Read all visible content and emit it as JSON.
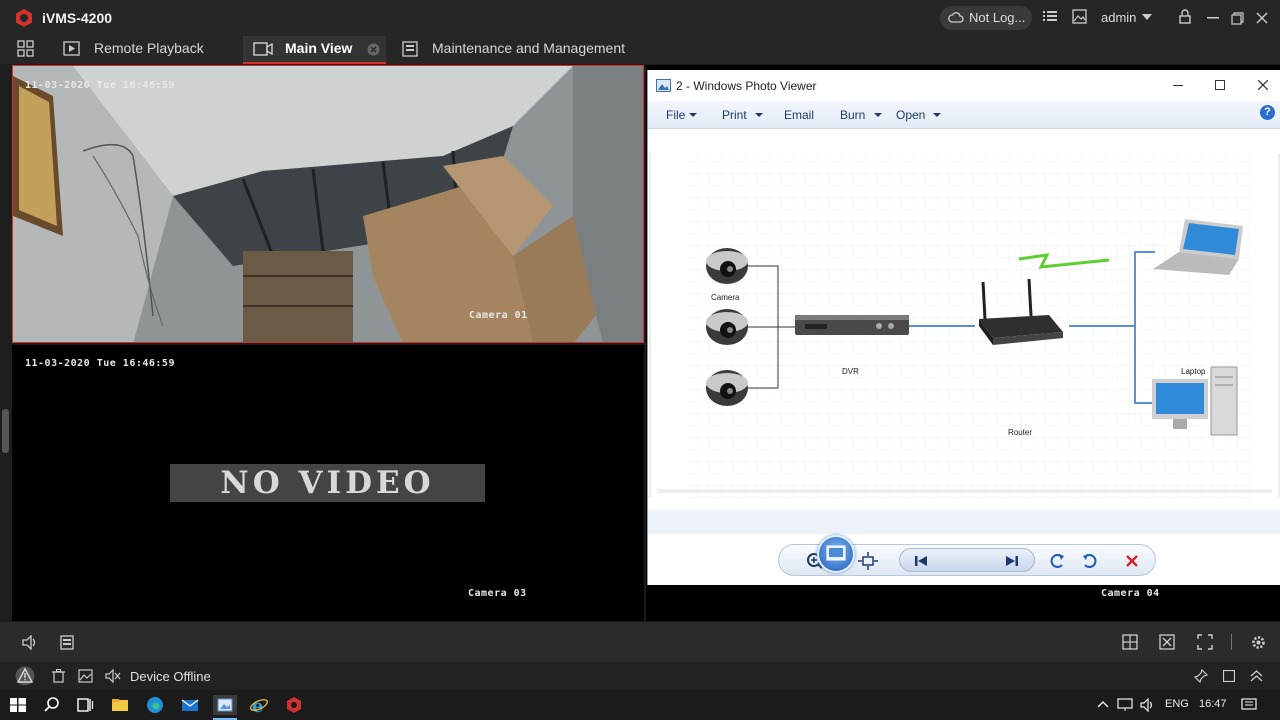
{
  "app": {
    "name": "iVMS-4200"
  },
  "topbar": {
    "cloud_status": "Not Log...",
    "user": "admin"
  },
  "tabs": [
    {
      "label": "Remote Playback"
    },
    {
      "label": "Main View"
    },
    {
      "label": "Maintenance and Management"
    }
  ],
  "panes": {
    "pane1": {
      "timestamp": "11-03-2020 Tue 16:46:59",
      "camera_label": "Camera 01"
    },
    "pane3": {
      "timestamp": "11-03-2020 Tue 16:46:59",
      "no_video": "NO VIDEO",
      "camera_label": "Camera 03"
    },
    "pane4": {
      "camera_label": "Camera 04"
    }
  },
  "photo_viewer": {
    "title": "2 - Windows Photo Viewer",
    "menu": [
      "File",
      "Print",
      "Email",
      "Burn",
      "Open"
    ],
    "diagram": {
      "labels": {
        "camera": "Camera",
        "dvr": "DVR",
        "router": "Router",
        "laptop": "Laptop",
        "pc": "PC"
      }
    }
  },
  "statusbar": {
    "text": "Device Offline"
  },
  "taskbar": {
    "lang": "ENG",
    "time": "16:47"
  },
  "colors": {
    "accent": "#d0322e",
    "background": "#1c1c1c"
  }
}
